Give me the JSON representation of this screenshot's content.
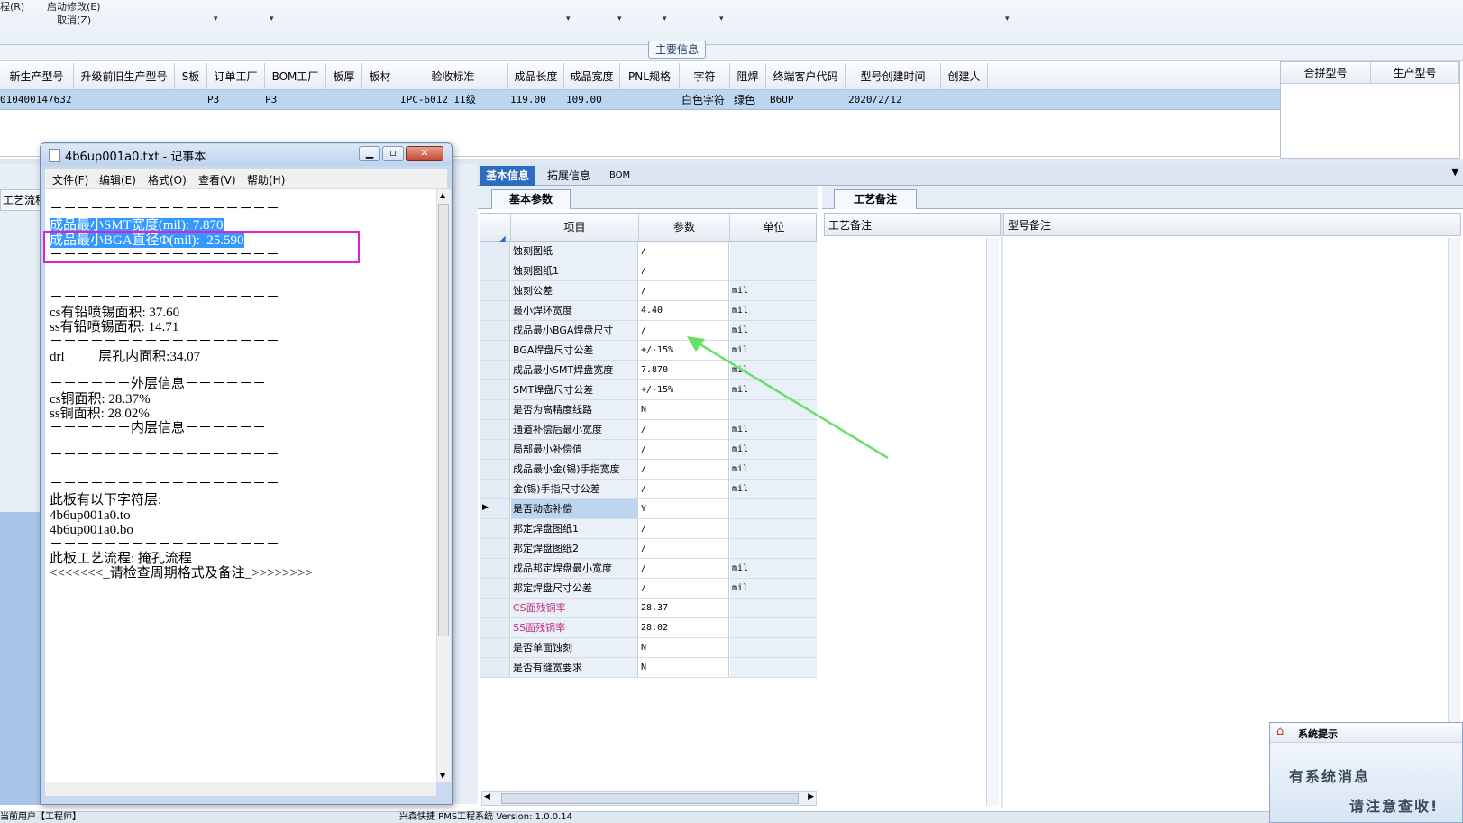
{
  "toolbar": {
    "item1": "程(R)",
    "item2": "启动修改(E)",
    "item3": "取消(Z)"
  },
  "main_info": {
    "section_label": "主要信息",
    "columns": [
      "新生产型号",
      "升级前旧生产型号",
      "S板",
      "订单工厂",
      "BOM工厂",
      "板厚",
      "板材",
      "验收标准",
      "成品长度",
      "成品宽度",
      "PNL规格",
      "字符",
      "阻焊",
      "终端客户代码",
      "型号创建时间",
      "创建人"
    ],
    "row": [
      "010400147632",
      "",
      "P3",
      "P3",
      "",
      "",
      "",
      "IPC-6012 II级",
      "119.00",
      "109.00",
      "",
      "白色字符",
      "绿色",
      "B6UP",
      "2020/2/12",
      ""
    ],
    "side_columns": [
      "合拼型号",
      "生产型号"
    ]
  },
  "left": {
    "tab_label": "工艺流程"
  },
  "center_tabs": {
    "basic": "基本信息",
    "extended": "拓展信息",
    "bom": "BOM"
  },
  "params": {
    "tab_label": "基本参数",
    "headers": {
      "item": "项目",
      "param": "参数",
      "unit": "单位"
    },
    "rows": [
      {
        "name": "蚀刻图纸",
        "value": "/",
        "unit": ""
      },
      {
        "name": "蚀刻图纸1",
        "value": "/",
        "unit": ""
      },
      {
        "name": "蚀刻公差",
        "value": "/",
        "unit": "mil"
      },
      {
        "name": "最小焊环宽度",
        "value": "4.40",
        "unit": "mil"
      },
      {
        "name": "成品最小BGA焊盘尺寸",
        "value": "/",
        "unit": "mil"
      },
      {
        "name": "BGA焊盘尺寸公差",
        "value": "+/-15%",
        "unit": "mil"
      },
      {
        "name": "成品最小SMT焊盘宽度",
        "value": "7.870",
        "unit": "mil"
      },
      {
        "name": "SMT焊盘尺寸公差",
        "value": "+/-15%",
        "unit": "mil"
      },
      {
        "name": "是否为高精度线路",
        "value": "N",
        "unit": ""
      },
      {
        "name": "通道补偿后最小宽度",
        "value": "/",
        "unit": "mil"
      },
      {
        "name": "局部最小补偿值",
        "value": "/",
        "unit": "mil"
      },
      {
        "name": "成品最小金(锡)手指宽度",
        "value": "/",
        "unit": "mil"
      },
      {
        "name": "金(锡)手指尺寸公差",
        "value": "/",
        "unit": "mil"
      },
      {
        "name": "是否动态补偿",
        "value": "Y",
        "unit": ""
      },
      {
        "name": "邦定焊盘图纸1",
        "value": "/",
        "unit": ""
      },
      {
        "name": "邦定焊盘图纸2",
        "value": "/",
        "unit": ""
      },
      {
        "name": "成品邦定焊盘最小宽度",
        "value": "/",
        "unit": "mil"
      },
      {
        "name": "邦定焊盘尺寸公差",
        "value": "/",
        "unit": "mil"
      },
      {
        "name": "CS面残铜率",
        "value": "28.37",
        "unit": ""
      },
      {
        "name": "SS面残铜率",
        "value": "28.02",
        "unit": ""
      },
      {
        "name": "是否单面蚀刻",
        "value": "N",
        "unit": ""
      },
      {
        "name": "是否有缝宽要求",
        "value": "N",
        "unit": ""
      }
    ]
  },
  "notes": {
    "tab_label": "工艺备注",
    "col1": "工艺备注",
    "col2": "型号备注"
  },
  "notepad": {
    "title": "4b6up001a0.txt - 记事本",
    "menu": [
      "文件(F)",
      "编辑(E)",
      "格式(O)",
      "查看(V)",
      "帮助(H)"
    ],
    "lines": [
      "－－－－－－－－－－－－－－－－－",
      "成品最小SMT宽度(mil): 7.870",
      "成品最小BGA直径Φ(mil):  25.590",
      "－－－－－－－－－－－－－－－－－",
      "－－－－－－－－－－－－－－－－－",
      "cs有铅喷锡面积: 37.60",
      "ss有铅喷锡面积: 14.71",
      "－－－－－－－－－－－－－－－－－",
      "drl          层孔内面积:34.07",
      "－－－－－－外层信息－－－－－－",
      "cs铜面积: 28.37%",
      "ss铜面积: 28.02%",
      "－－－－－－内层信息－－－－－－",
      "－－－－－－－－－－－－－－－－－",
      "－－－－－－－－－－－－－－－－－",
      "此板有以下字符层:",
      "4b6up001a0.to",
      "4b6up001a0.bo",
      "－－－－－－－－－－－－－－－－－",
      "此板工艺流程: 掩孔流程",
      "<<<<<<<_请检查周期格式及备注_>>>>>>>>"
    ]
  },
  "sysmsg": {
    "title": "系统提示",
    "line1": "有系统消息",
    "line2": "请注意查收!"
  },
  "status": {
    "left": "当前用户【工程师】",
    "center": "兴森快捷 PMS工程系统 Version: 1.0.0.14"
  },
  "colors": {
    "highlight_frame": "#e020c8",
    "arrow": "#66e066",
    "selection": "#3399ff",
    "copper_label": "#c03080"
  }
}
